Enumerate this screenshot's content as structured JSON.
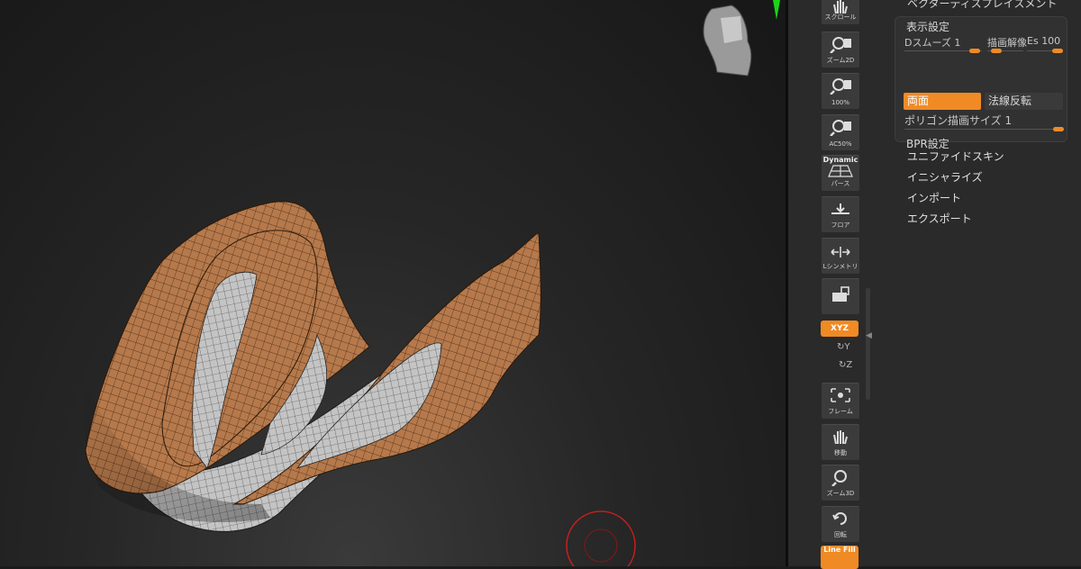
{
  "top_item": {
    "label": "ベクターディスプレイスメント"
  },
  "display_settings": {
    "title": "表示設定",
    "dsmooth": {
      "label": "Dスムーズ",
      "value": "1"
    },
    "draw_res": {
      "label": "描画解像",
      "value": ""
    },
    "es": {
      "label": "Es",
      "value": "100"
    },
    "double_sided": {
      "label": "両面",
      "active": true
    },
    "flip_normals": {
      "label": "法線反転",
      "active": false
    },
    "poly_size": {
      "label": "ポリゴン描画サイズ",
      "value": "1"
    },
    "bpr": {
      "label": "BPR設定"
    }
  },
  "menu": [
    {
      "label": "ユニファイドスキン"
    },
    {
      "label": "イニシャライズ"
    },
    {
      "label": "インポート"
    },
    {
      "label": "エクスポート"
    }
  ],
  "toolbar": {
    "scroll": "スクロール",
    "zoom2d": "ズーム2D",
    "pct100": "100%",
    "ac50": "AC50%",
    "dynamic": "Dynamic",
    "perspective": "パース",
    "floor": "フロア",
    "lsym": "Lシンメトリ",
    "xyz": "XYZ",
    "rot_y": "Y",
    "rot_z": "Z",
    "frame": "フレーム",
    "move": "移動",
    "zoom3d": "ズーム3D",
    "rotate": "回転",
    "linefill": "Line Fill"
  },
  "colors": {
    "accent": "#f08a24",
    "panel_bg": "#2a2a2a",
    "mesh_outer": "#b87b4e",
    "mesh_inner": "#bfbfbf"
  }
}
